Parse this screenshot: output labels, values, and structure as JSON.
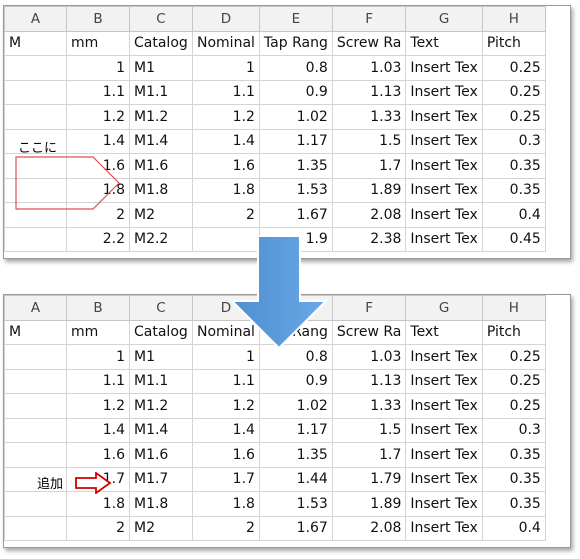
{
  "columns": [
    "A",
    "B",
    "C",
    "D",
    "E",
    "F",
    "G",
    "H"
  ],
  "header_row": [
    "M",
    "mm",
    "Catalog",
    "Nominal",
    "Tap Rang",
    "Screw Ra",
    "Text",
    "Pitch"
  ],
  "top_rows": [
    [
      "",
      "1",
      "M1",
      "1",
      "0.8",
      "1.03",
      "Insert Tex",
      "0.25"
    ],
    [
      "",
      "1.1",
      "M1.1",
      "1.1",
      "0.9",
      "1.13",
      "Insert Tex",
      "0.25"
    ],
    [
      "",
      "1.2",
      "M1.2",
      "1.2",
      "1.02",
      "1.33",
      "Insert Tex",
      "0.25"
    ],
    [
      "",
      "1.4",
      "M1.4",
      "1.4",
      "1.17",
      "1.5",
      "Insert Tex",
      "0.3"
    ],
    [
      "",
      "1.6",
      "M1.6",
      "1.6",
      "1.35",
      "1.7",
      "Insert Tex",
      "0.35"
    ],
    [
      "",
      "1.8",
      "M1.8",
      "1.8",
      "1.53",
      "1.89",
      "Insert Tex",
      "0.35"
    ],
    [
      "",
      "2",
      "M2",
      "2",
      "1.67",
      "2.08",
      "Insert Tex",
      "0.4"
    ],
    [
      "",
      "2.2",
      "M2.2",
      "",
      "1.9",
      "2.38",
      "Insert Tex",
      "0.45"
    ]
  ],
  "bottom_rows": [
    [
      "",
      "1",
      "M1",
      "1",
      "0.8",
      "1.03",
      "Insert Tex",
      "0.25"
    ],
    [
      "",
      "1.1",
      "M1.1",
      "1.1",
      "0.9",
      "1.13",
      "Insert Tex",
      "0.25"
    ],
    [
      "",
      "1.2",
      "M1.2",
      "1.2",
      "1.02",
      "1.33",
      "Insert Tex",
      "0.25"
    ],
    [
      "",
      "1.4",
      "M1.4",
      "1.4",
      "1.17",
      "1.5",
      "Insert Tex",
      "0.3"
    ],
    [
      "",
      "1.6",
      "M1.6",
      "1.6",
      "1.35",
      "1.7",
      "Insert Tex",
      "0.35"
    ],
    [
      "",
      "1.7",
      "M1.7",
      "1.7",
      "1.44",
      "1.79",
      "Insert Tex",
      "0.35"
    ],
    [
      "",
      "1.8",
      "M1.8",
      "1.8",
      "1.53",
      "1.89",
      "Insert Tex",
      "0.35"
    ],
    [
      "",
      "2",
      "M2",
      "2",
      "1.67",
      "2.08",
      "Insert Tex",
      "0.4"
    ]
  ],
  "annotations": {
    "insert_here_label": "ここに",
    "added_label": "追加",
    "pentagon_color": "#e05050",
    "red_arrow_color": "#d00000",
    "big_arrow_color": "#5b9bd5"
  }
}
